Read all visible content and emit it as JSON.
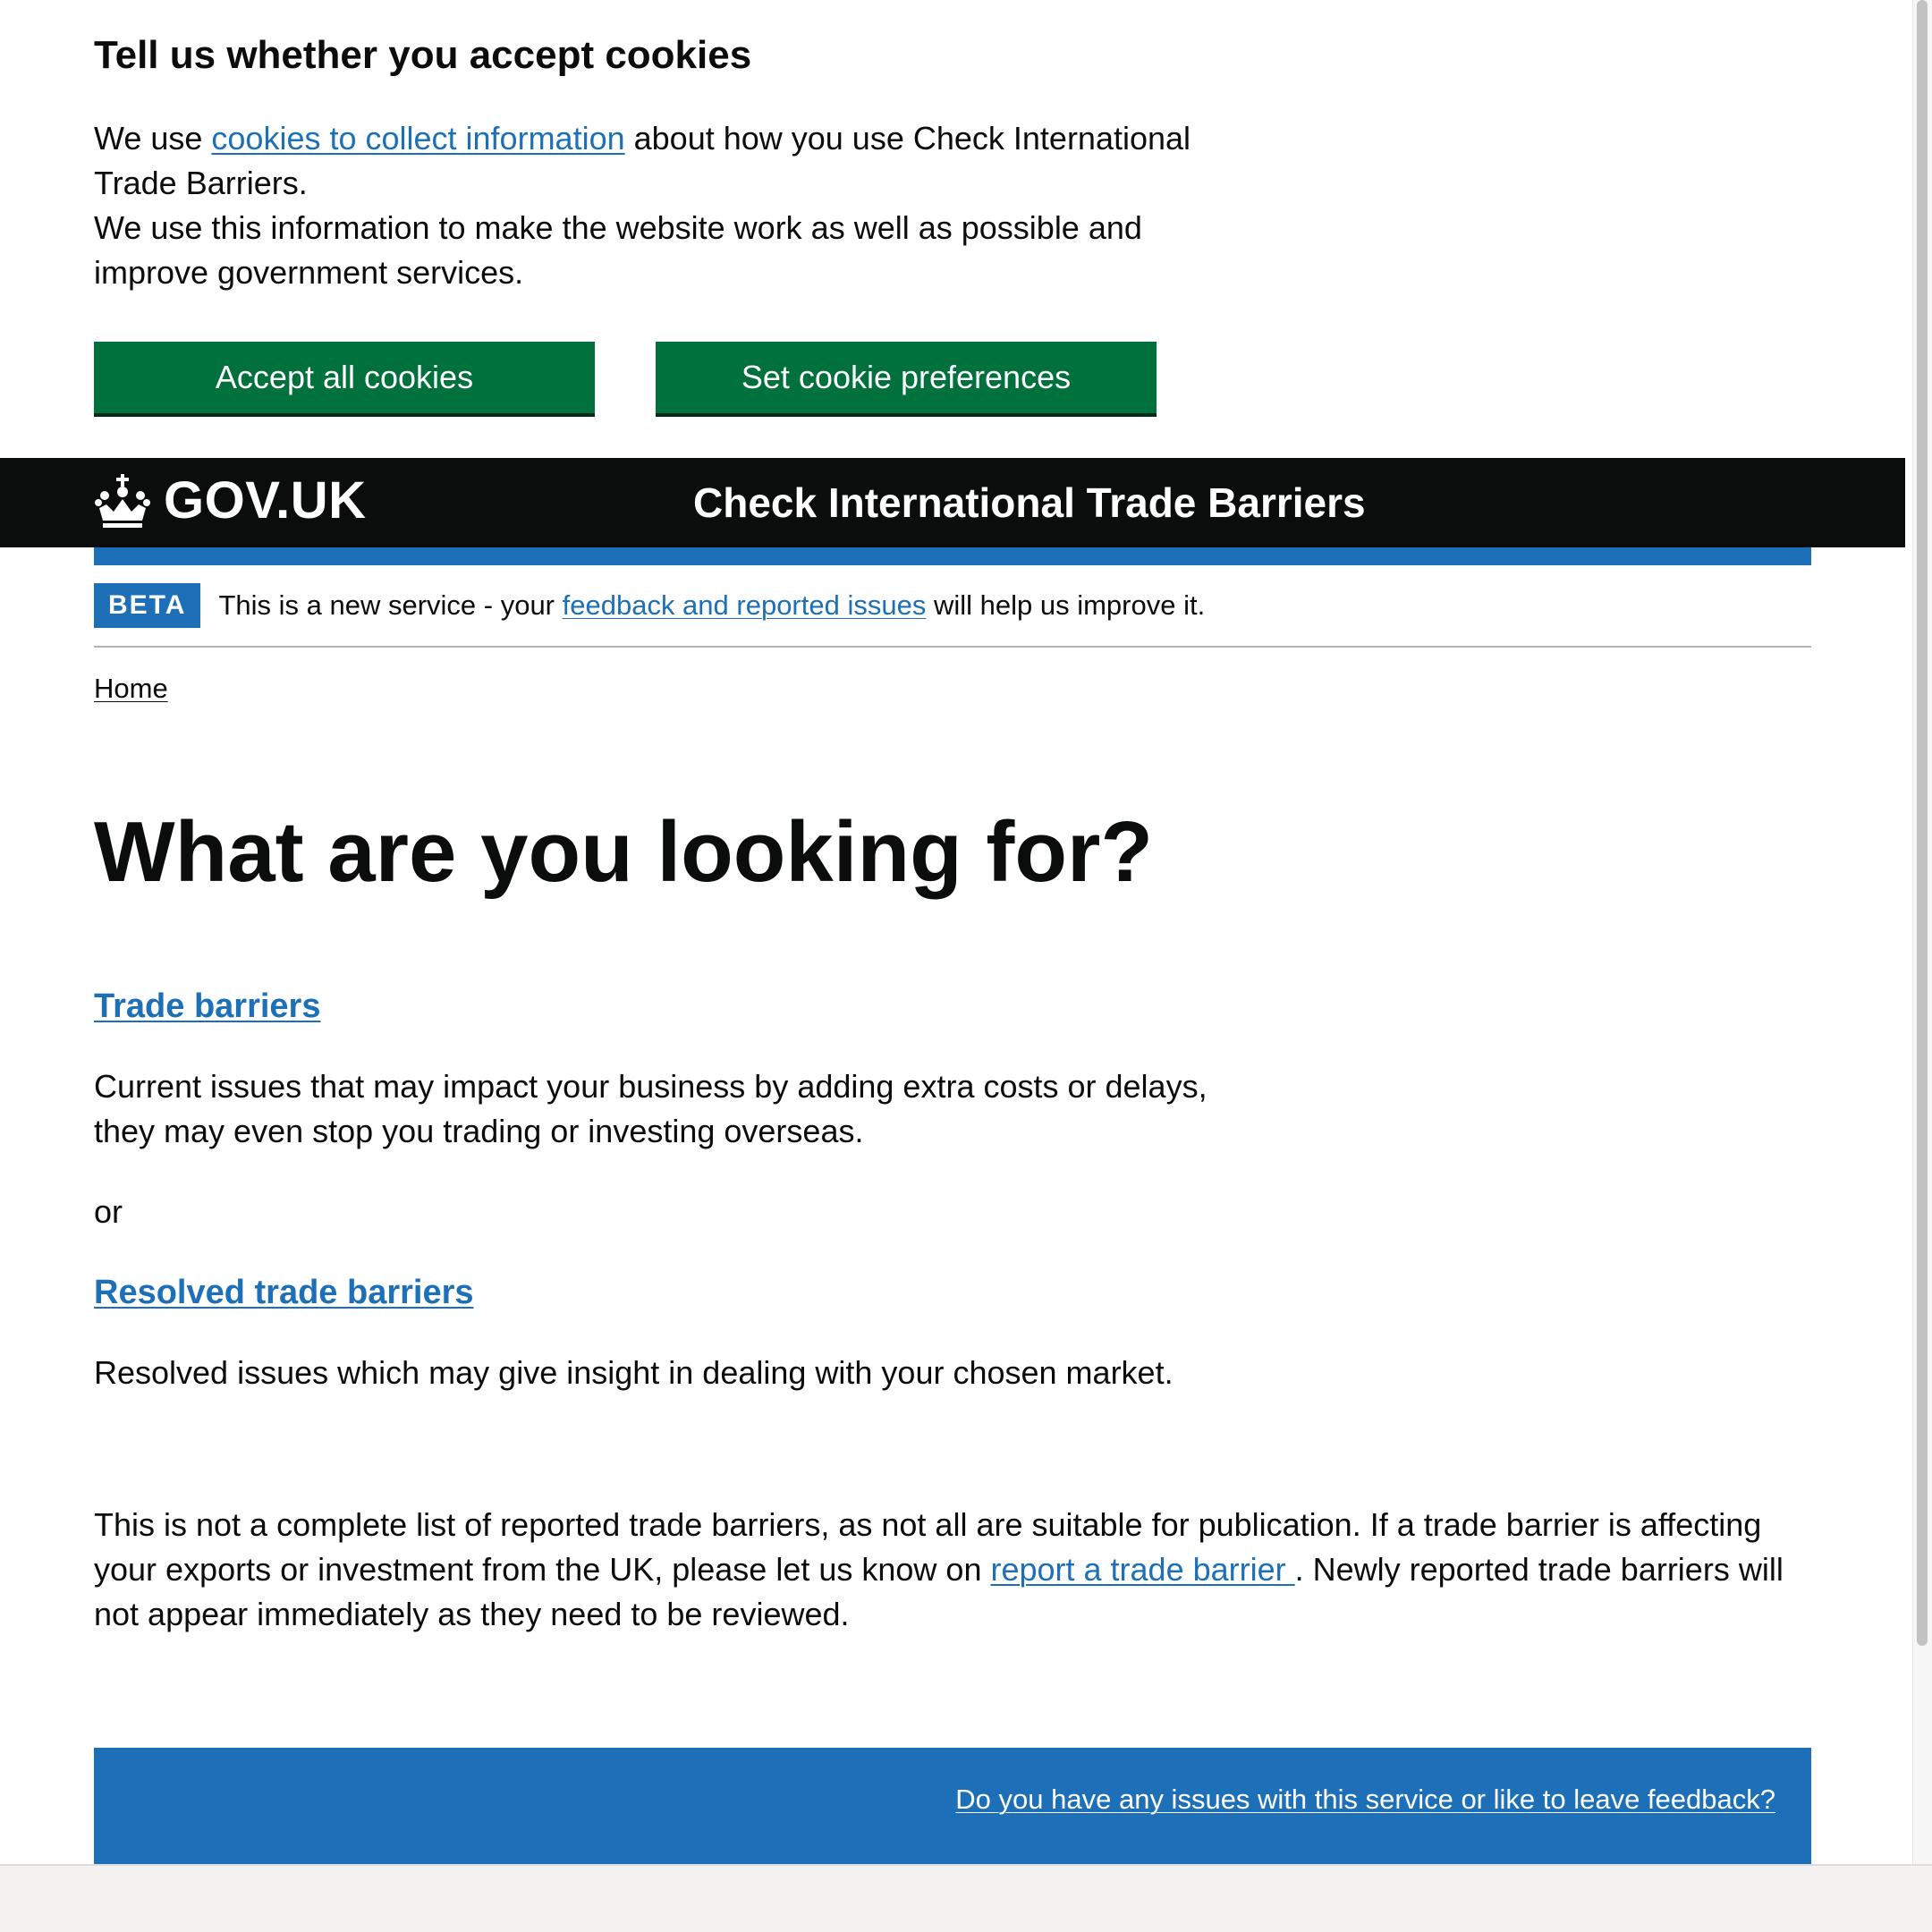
{
  "cookie_banner": {
    "title": "Tell us whether you accept cookies",
    "text_before_link": "We use ",
    "link_text": "cookies to collect information",
    "text_after_link": " about how you use Check International Trade Barriers.",
    "text_second": "We use this information to make the website work as well as possible and improve government services.",
    "accept_button": "Accept all cookies",
    "preferences_button": "Set cookie preferences"
  },
  "header": {
    "logo_text": "GOV.UK",
    "service_name": "Check International Trade Barriers"
  },
  "phase_banner": {
    "tag": "BETA",
    "text_before_link": "This is a new service - your ",
    "link_text": "feedback and reported issues",
    "text_after_link": " will help us improve it."
  },
  "breadcrumb": {
    "home": "Home"
  },
  "main": {
    "title": "What are you looking for?",
    "trade_barriers_link": "Trade barriers",
    "trade_barriers_desc": "Current issues that may impact your business by adding extra costs or delays, they may even stop you trading or investing overseas.",
    "or_text": "or",
    "resolved_link": "Resolved trade barriers",
    "resolved_desc": "Resolved issues which may give insight in dealing with your chosen market.",
    "note_before_link": "This is not a complete list of reported trade barriers, as not all are suitable for publication. If a trade barrier is affecting your exports or investment from the UK, please let us know on ",
    "note_link": "report a trade barrier ",
    "note_after_link": ". Newly reported trade barriers will not appear immediately as they need to be reviewed."
  },
  "footer": {
    "feedback_link": "Do you have any issues with this service or like to leave feedback?"
  },
  "colors": {
    "button_green": "#00703c",
    "link_blue": "#1d70b8",
    "header_black": "#0b0c0c"
  },
  "icons": {
    "logo": "crown-icon"
  }
}
